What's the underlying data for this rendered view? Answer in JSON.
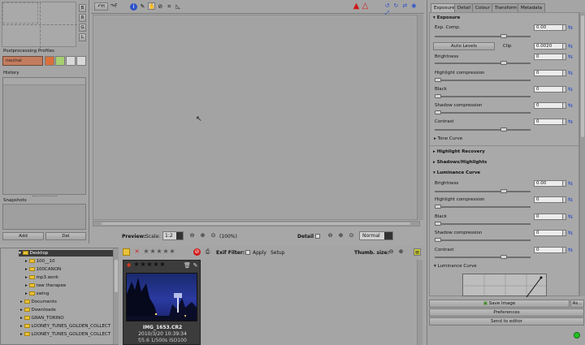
{
  "left": {
    "side_buttons": [
      "B",
      "R",
      "G",
      "L"
    ],
    "pp_profiles_title": "Postprocessing Profiles",
    "profile_value": "neutral",
    "history_title": "History",
    "snapshots_title": "Snapshots",
    "add_label": "Add",
    "del_label": "Del"
  },
  "toolbar": {
    "before_label": "H",
    "after_label": "F"
  },
  "preview": {
    "preview_label": "Preview:",
    "scale_label": "Scale:",
    "scale_value": "1:2",
    "zoom_text": "(100%)",
    "detail_label": "Detail",
    "mode_value": "Normal"
  },
  "tree": {
    "items": [
      {
        "label": "Desktop",
        "selected": true
      },
      {
        "label": "100__10"
      },
      {
        "label": "100CANON"
      },
      {
        "label": "mp3.work"
      },
      {
        "label": "raw therapee"
      },
      {
        "label": "swing"
      },
      {
        "label": "Documents"
      },
      {
        "label": "Downloads"
      },
      {
        "label": "GRAN_TORINO"
      },
      {
        "label": "LOONEY_TUNES_GOLDEN_COLLECT"
      },
      {
        "label": "LOONEY_TUNES_GOLDEN_COLLECT"
      }
    ]
  },
  "browser": {
    "exif_label": "Exif Filter:",
    "apply_label": "Apply",
    "setup_label": "Setup",
    "thumb_size_label": "Thumb. size:",
    "thumb": {
      "name": "IMG_1653.CR2",
      "date": "2010/3/20 10:39:34",
      "exif": "f/5.6 1/500s ISO100"
    }
  },
  "right": {
    "tabs": [
      "Exposure",
      "Detail",
      "Colour",
      "Transform",
      "Metadata"
    ],
    "exposure_title": "Exposure",
    "exp_comp_label": "Exp. Comp.",
    "exp_comp_value": "0.00",
    "auto_levels_label": "Auto Levels",
    "clip_label": "Clip",
    "clip_value": "0.0020",
    "brightness_label": "Brightness",
    "brightness_value": "0",
    "highlight_comp_label": "Highlight compression",
    "highlight_comp_value": "0",
    "black_label": "Black",
    "black_value": "0",
    "shadow_comp_label": "Shadow compression",
    "shadow_comp_value": "0",
    "contrast_label": "Contrast",
    "contrast_value": "0",
    "tone_curve_label": "Tone Curve",
    "highlight_recovery_label": "Highlight Recovery",
    "shadows_highlights_label": "Shadows/Highlights",
    "luminance_curve_label": "Luminance Curve",
    "lum_brightness_label": "Brightness",
    "lum_brightness_value": "0.00",
    "lum_highlight_label": "Highlight compression",
    "lum_highlight_value": "0",
    "lum_black_label": "Black",
    "lum_black_value": "0",
    "lum_shadow_label": "Shadow compression",
    "lum_shadow_value": "0",
    "lum_contrast_label": "Contrast",
    "lum_contrast_value": "0",
    "lum_curve_label": "Luminance Curve",
    "save_image_label": "Save Image",
    "as_label": "As...",
    "preferences_label": "Preferences",
    "send_editor_label": "Send to editor"
  },
  "colors": {
    "accent_blue": "#2f52c8",
    "warning_red": "#d01818",
    "status_green": "#22c322",
    "thumb_bg": "#3c3c3c"
  }
}
